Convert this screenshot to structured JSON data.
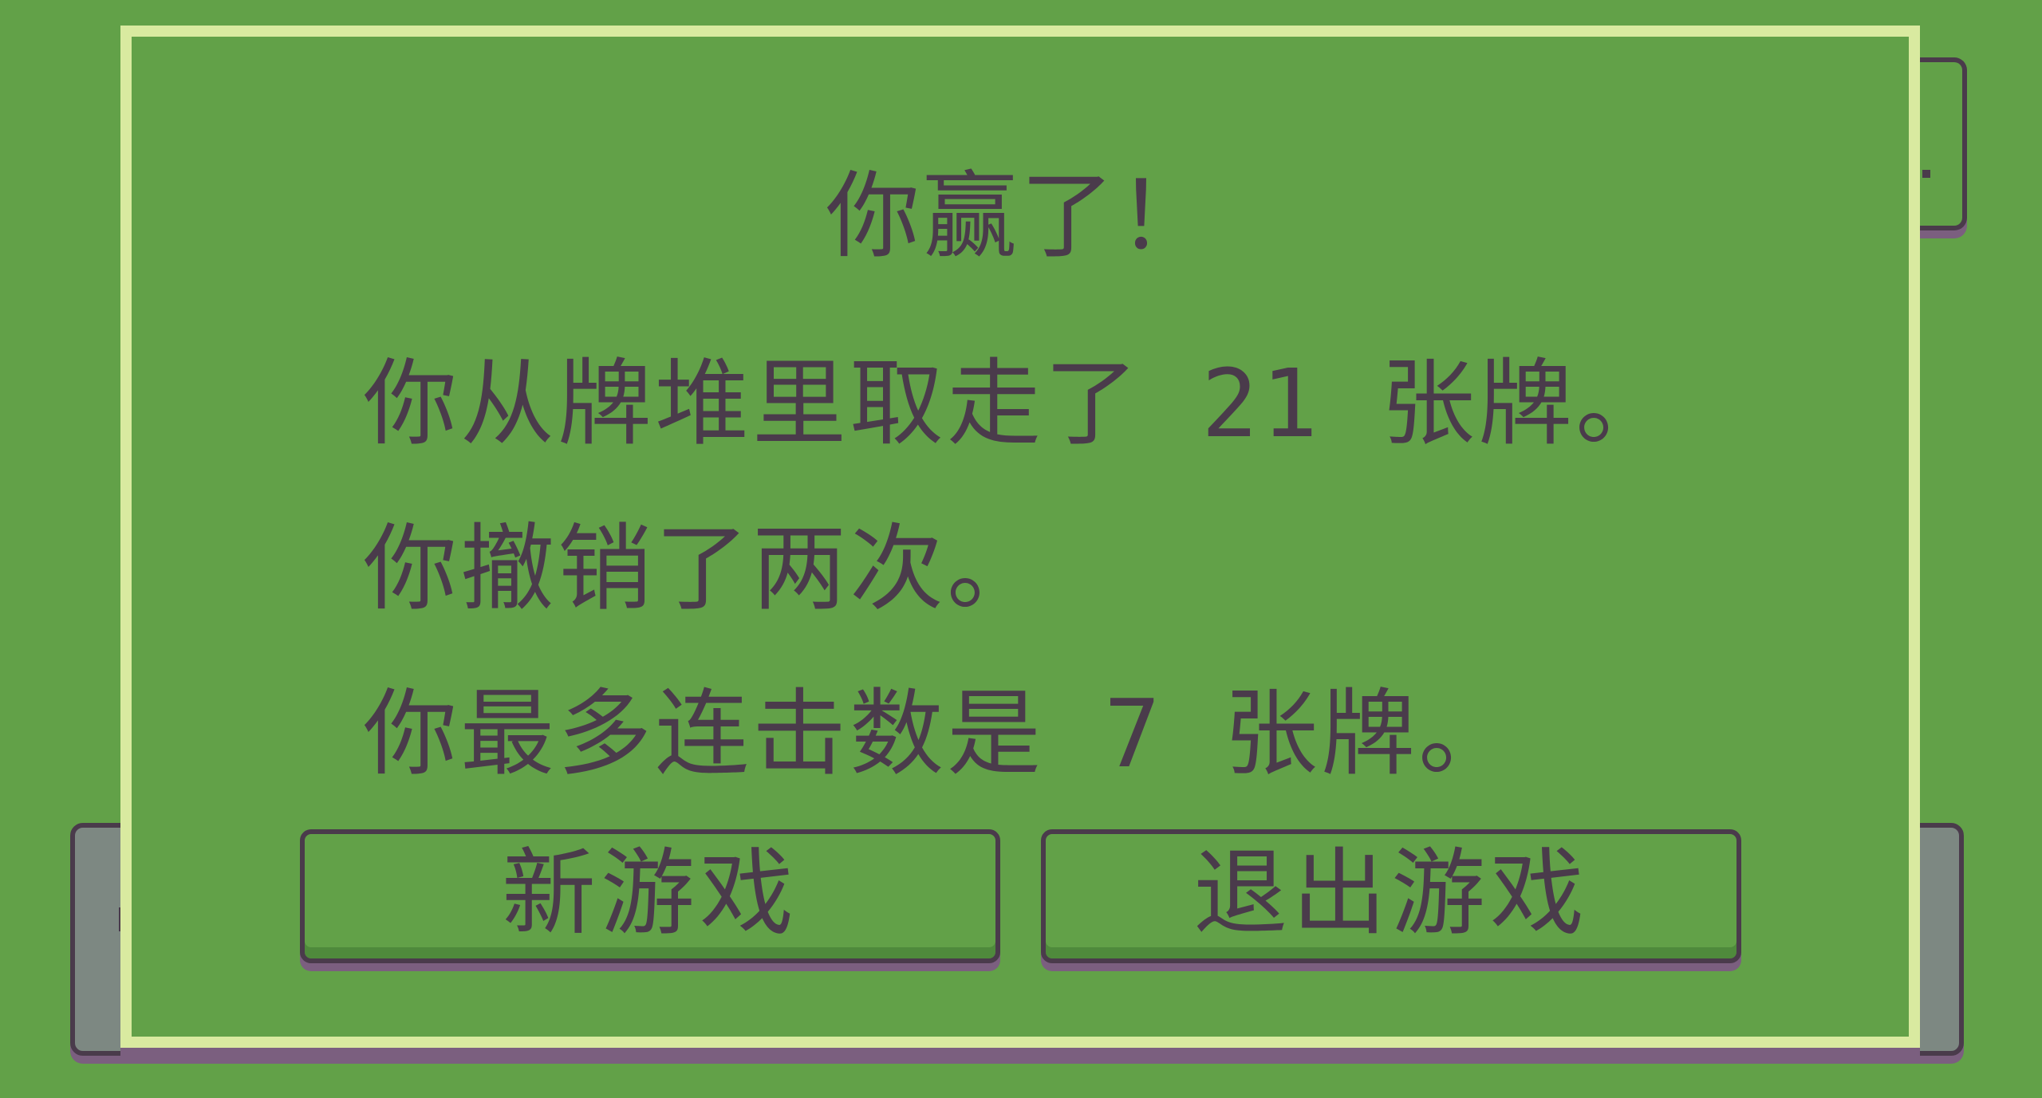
{
  "dialog": {
    "title": "你赢了！",
    "stats": [
      "你从牌堆里取走了 21 张牌。",
      "你撤销了两次。",
      "你最多连击数是 7 张牌。"
    ],
    "buttons": {
      "new_game": "新游戏",
      "quit_game": "退出游戏"
    }
  },
  "colors": {
    "background": "#62a148",
    "dialog_border": "#d9eaa0",
    "text": "#4a3b4b",
    "shadow": "#7b5f7f",
    "panel_gray": "#7d8882"
  }
}
